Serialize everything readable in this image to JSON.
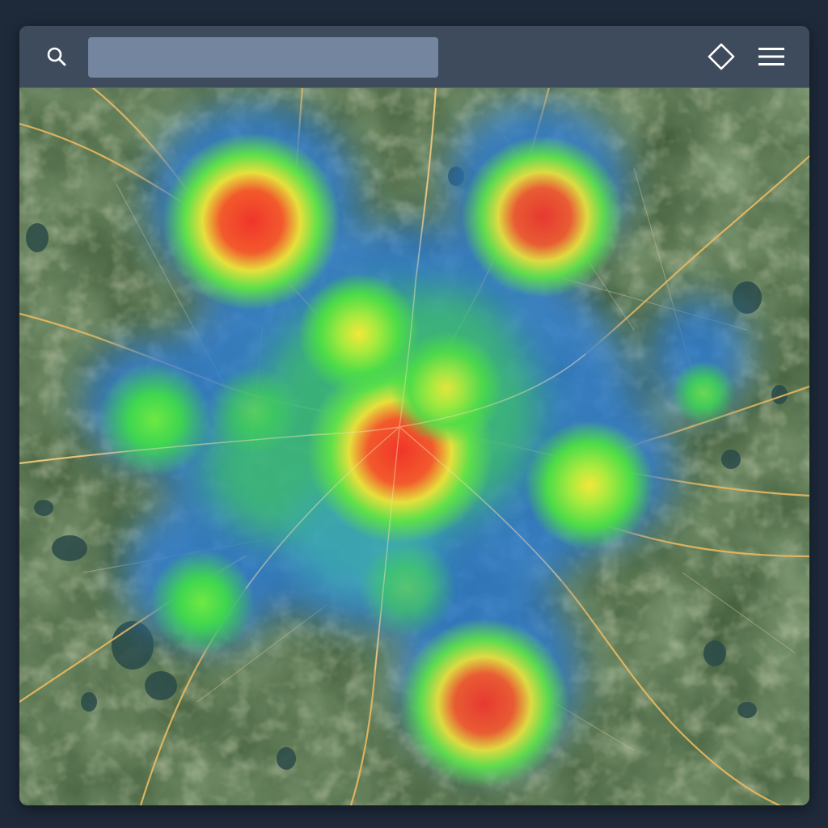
{
  "app": {
    "background_color": "#1e2a3a",
    "toolbar_color": "#3d4b5c"
  },
  "toolbar": {
    "search": {
      "icon": "search-icon",
      "value": "",
      "placeholder": ""
    },
    "layers_icon": "diamond-layers-icon",
    "menu_icon": "hamburger-menu-icon"
  },
  "map": {
    "base_style": "satellite",
    "land_color": "#3f5a37",
    "road_color": "#e8b860",
    "heatmap_gradient": [
      "#2a7bd8",
      "#3fb0c8",
      "#5ee04a",
      "#e6e03c",
      "#f0452d"
    ]
  }
}
